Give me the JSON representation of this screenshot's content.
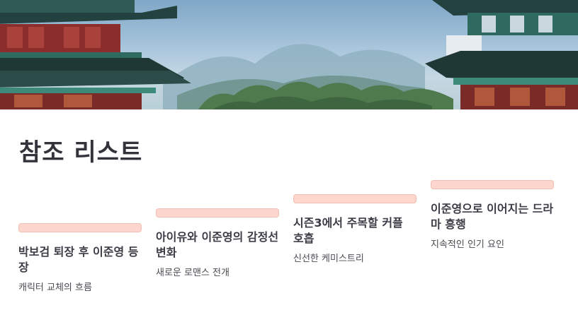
{
  "page": {
    "title": "참조 리스트"
  },
  "hero": {
    "image": "korean-palace-pavilion-landscape"
  },
  "cards": [
    {
      "title": "박보검 퇴장 후 이준영 등장",
      "subtitle": "캐릭터 교체의 흐름"
    },
    {
      "title": "아이유와 이준영의 감정선 변화",
      "subtitle": "새로운 로맨스 전개"
    },
    {
      "title": "시즌3에서 주목할 커플 호흡",
      "subtitle": "신선한 케미스트리"
    },
    {
      "title": "이준영으로 이어지는 드라마 흥행",
      "subtitle": "지속적인 인기 요인"
    }
  ],
  "colors": {
    "accent_bar": "#fdd7ce",
    "heading": "#34333c"
  }
}
